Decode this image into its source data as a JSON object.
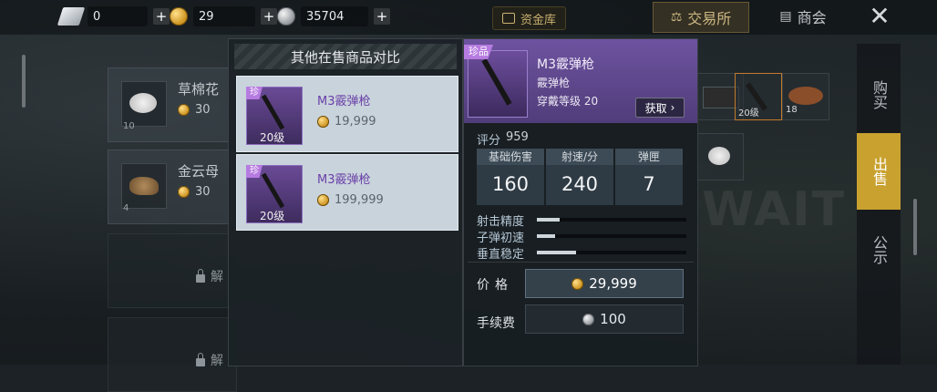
{
  "currencies": [
    {
      "icon": "diamond-icon",
      "value": "0"
    },
    {
      "icon": "gold-coin-icon",
      "value": "29"
    },
    {
      "icon": "silver-coin-icon",
      "value": "35704"
    }
  ],
  "top": {
    "vault": "资金库",
    "tab_exchange": "交易所",
    "tab_shop": "商会",
    "close": "✕"
  },
  "side_tabs": [
    "购买",
    "出售",
    "公示"
  ],
  "inventory": [
    {
      "name": "草棉花",
      "price": "30",
      "qty": "10"
    },
    {
      "name": "金云母",
      "price": "30",
      "qty": "4"
    }
  ],
  "locked_label": "解",
  "grid_cells": [
    {
      "qty": "20级"
    },
    {
      "qty": "18"
    }
  ],
  "compare": {
    "title": "其他在售商品对比",
    "offers": [
      {
        "tag": "珍",
        "level": "20级",
        "name": "M3霰弹枪",
        "price": "19,999"
      },
      {
        "tag": "珍",
        "level": "20级",
        "name": "M3霰弹枪",
        "price": "199,999"
      }
    ]
  },
  "detail": {
    "tag": "珍品",
    "name": "M3霰弹枪",
    "type": "霰弹枪",
    "wear_level": "穿戴等级 20",
    "get_button": "获取",
    "score_label": "评分",
    "score_value": "959",
    "stats": [
      {
        "label": "基础伤害",
        "value": "160"
      },
      {
        "label": "射速/分",
        "value": "240"
      },
      {
        "label": "弹匣",
        "value": "7"
      }
    ],
    "bars": [
      {
        "label": "射击精度",
        "fill": 0.15
      },
      {
        "label": "子弹初速",
        "fill": 0.12
      },
      {
        "label": "垂直稳定",
        "fill": 0.26
      }
    ],
    "price_label": "价格",
    "price_value": "29,999",
    "fee_label": "手续费",
    "fee_value": "100"
  },
  "colors": {
    "accent_purple": "#6e53a0",
    "gold_tab": "#c9a12f",
    "offer_bg": "#c9d3dc"
  }
}
